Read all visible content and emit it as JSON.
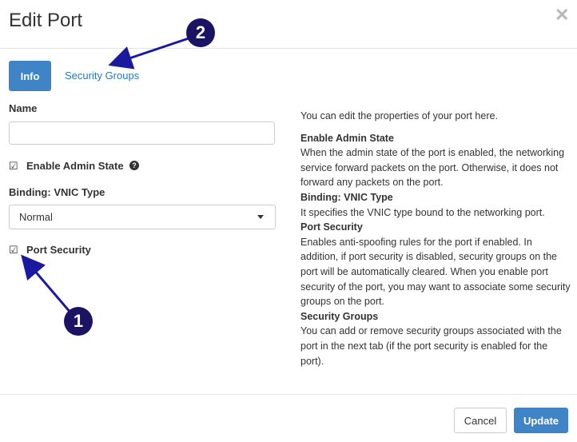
{
  "dialog": {
    "title": "Edit Port",
    "close_glyph": "✕"
  },
  "tabs": [
    {
      "label": "Info",
      "active": true
    },
    {
      "label": "Security Groups",
      "active": false
    }
  ],
  "form": {
    "name_label": "Name",
    "name_value": "",
    "enable_admin_state": {
      "label": "Enable Admin State",
      "checked": true,
      "help_glyph": "?"
    },
    "vnic_label": "Binding: VNIC Type",
    "vnic_value": "Normal",
    "port_security": {
      "label": "Port Security",
      "checked": true
    }
  },
  "help": {
    "intro": "You can edit the properties of your port here.",
    "sections": [
      {
        "heading": "Enable Admin State",
        "text": "When the admin state of the port is enabled, the networking service forward packets on the port. Otherwise, it does not forward any packets on the port."
      },
      {
        "heading": "Binding: VNIC Type",
        "text": "It specifies the VNIC type bound to the networking port."
      },
      {
        "heading": "Port Security",
        "text": "Enables anti-spoofing rules for the port if enabled. In addition, if port security is disabled, security groups on the port will be automatically cleared. When you enable port security of the port, you may want to associate some security groups on the port."
      },
      {
        "heading": "Security Groups",
        "text": "You can add or remove security groups associated with the port in the next tab (if the port security is enabled for the port)."
      }
    ]
  },
  "footer": {
    "cancel_label": "Cancel",
    "update_label": "Update"
  },
  "annotations": [
    {
      "number": "1"
    },
    {
      "number": "2"
    }
  ],
  "colors": {
    "primary": "#3f84c7",
    "link": "#2a7ab8",
    "callout": "#1b1464",
    "arrow": "#1a1aa0"
  }
}
